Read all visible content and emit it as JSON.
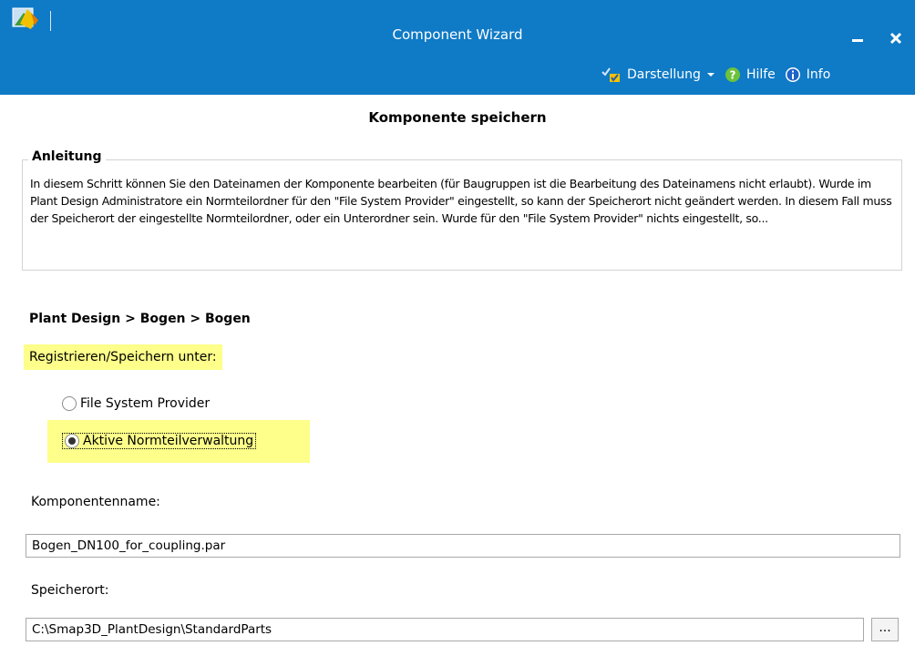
{
  "window": {
    "title": "Component Wizard",
    "accent_color": "#0f7ac6",
    "app_icon": "wizard-app-icon",
    "minimize_icon": "minimize-icon",
    "close_icon": "close-icon"
  },
  "toolbar": {
    "darstellung_label": "Darstellung",
    "darstellung_icon": "checklist-icon",
    "hilfe_label": "Hilfe",
    "hilfe_icon": "help-icon",
    "info_label": "Info",
    "info_icon": "info-icon"
  },
  "page": {
    "title": "Komponente speichern"
  },
  "instructions": {
    "heading": "Anleitung",
    "text": "In diesem Schritt können Sie den Dateinamen der Komponente bearbeiten (für Baugruppen ist die Bearbeitung des Dateinamens nicht erlaubt). Wurde im Plant Design Administratore ein Normteilordner für den \"File System Provider\" eingestellt, so kann der Speicherort nicht geändert werden. In diesem Fall muss der Speicherort der eingestellte Normteilordner, oder ein Unterordner sein. Wurde für den \"File System Provider\" nichts eingestellt, so..."
  },
  "breadcrumb": "Plant Design > Bogen > Bogen",
  "register": {
    "label": "Registrieren/Speichern unter:",
    "highlight_color": "#fdff8a",
    "options": [
      {
        "label": "File System Provider",
        "checked": false
      },
      {
        "label": "Aktive Normteilverwaltung",
        "checked": true
      }
    ]
  },
  "component_name": {
    "label": "Komponentenname:",
    "value": "Bogen_DN100_for_coupling.par"
  },
  "location": {
    "label": "Speicherort:",
    "value": "C:\\Smap3D_PlantDesign\\StandardParts",
    "browse_label": "..."
  }
}
